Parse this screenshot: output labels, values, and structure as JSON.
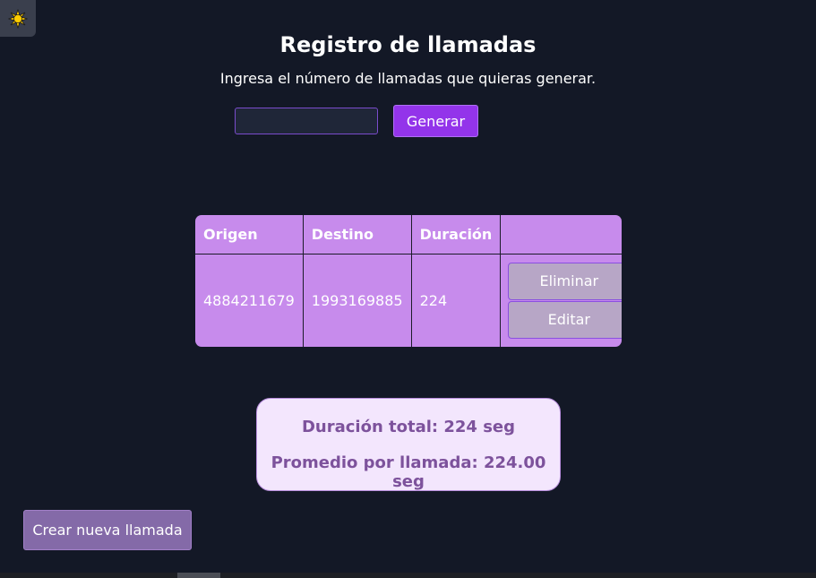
{
  "theme_toggle": {
    "icon": "sun-icon",
    "color": "#ffcc00"
  },
  "header": {
    "title": "Registro de llamadas",
    "subtitle": "Ingresa el número de llamadas que quieras generar."
  },
  "generator": {
    "input_value": "",
    "input_placeholder": "",
    "button_label": "Generar",
    "accent": "#9334ea"
  },
  "table": {
    "headers": [
      "Origen",
      "Destino",
      "Duración",
      ""
    ],
    "rows": [
      {
        "origen": "4884211679",
        "destino": "1993169885",
        "duracion": "224",
        "delete_label": "Eliminar",
        "edit_label": "Editar"
      }
    ],
    "background": "#c78bec"
  },
  "summary": {
    "total": "Duración total: 224 seg",
    "average": "Promedio por llamada: 224.00 seg"
  },
  "footer": {
    "new_call_label": "Crear nueva llamada"
  }
}
